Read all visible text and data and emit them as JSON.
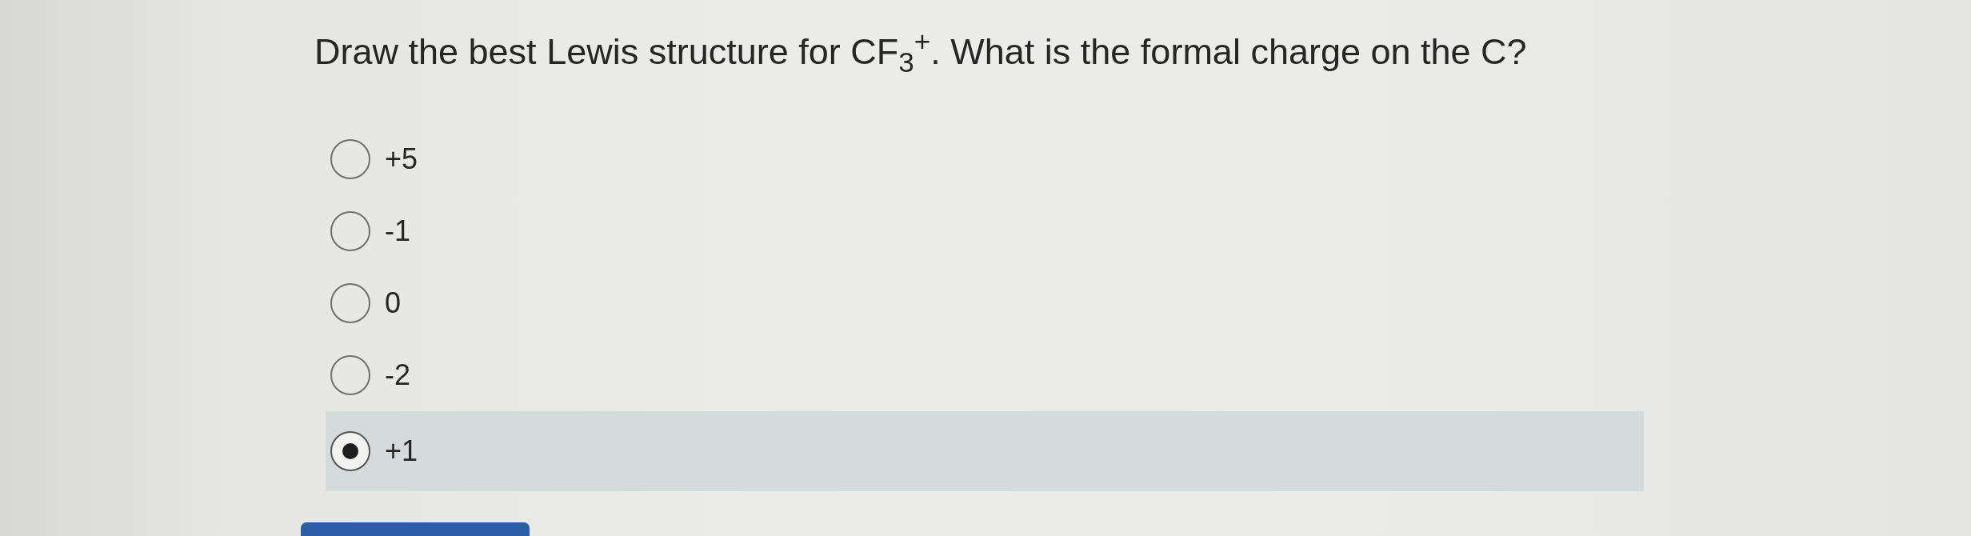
{
  "question": {
    "text": "Draw the best Lewis structure for CF$_{3}$$^{+}$. What is the formal charge on the C?"
  },
  "options": [
    {
      "label": "+5",
      "selected": false
    },
    {
      "label": "-1",
      "selected": false
    },
    {
      "label": "0",
      "selected": false
    },
    {
      "label": "-2",
      "selected": false
    },
    {
      "label": "+1",
      "selected": true
    }
  ]
}
